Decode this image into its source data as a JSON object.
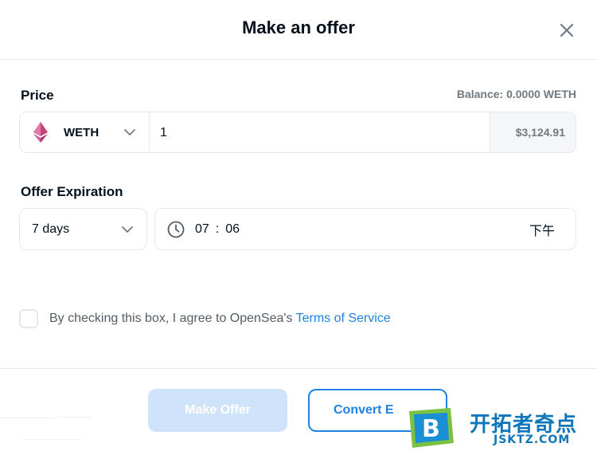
{
  "modal": {
    "title": "Make an offer"
  },
  "price": {
    "label": "Price",
    "balance": "Balance: 0.0000 WETH",
    "currency": "WETH",
    "amount": "1",
    "usd_value": "$3,124.91"
  },
  "expiration": {
    "label": "Offer Expiration",
    "duration": "7 days",
    "hour": "07",
    "separator": ":",
    "minute": "06",
    "period": "下午"
  },
  "terms": {
    "text": "By checking this box, I agree to OpenSea's ",
    "link": "Terms of Service",
    "checked": false
  },
  "footer": {
    "make_offer_label": "Make Offer",
    "convert_label": "Convert E"
  },
  "watermark": {
    "title": "开拓者奇点",
    "subtitle": "JSKTZ.COM",
    "logo_letter": "B"
  },
  "colors": {
    "accent": "#2081e2",
    "disabled_button": "#cfe3fa",
    "eth_pink": "#c0457a",
    "watermark_blue": "#0e76b9",
    "watermark_green": "#7cc242"
  },
  "icons": {
    "close": "close-icon",
    "currency": "ethereum-icon",
    "dropdown": "chevron-down-icon",
    "time": "clock-icon"
  }
}
